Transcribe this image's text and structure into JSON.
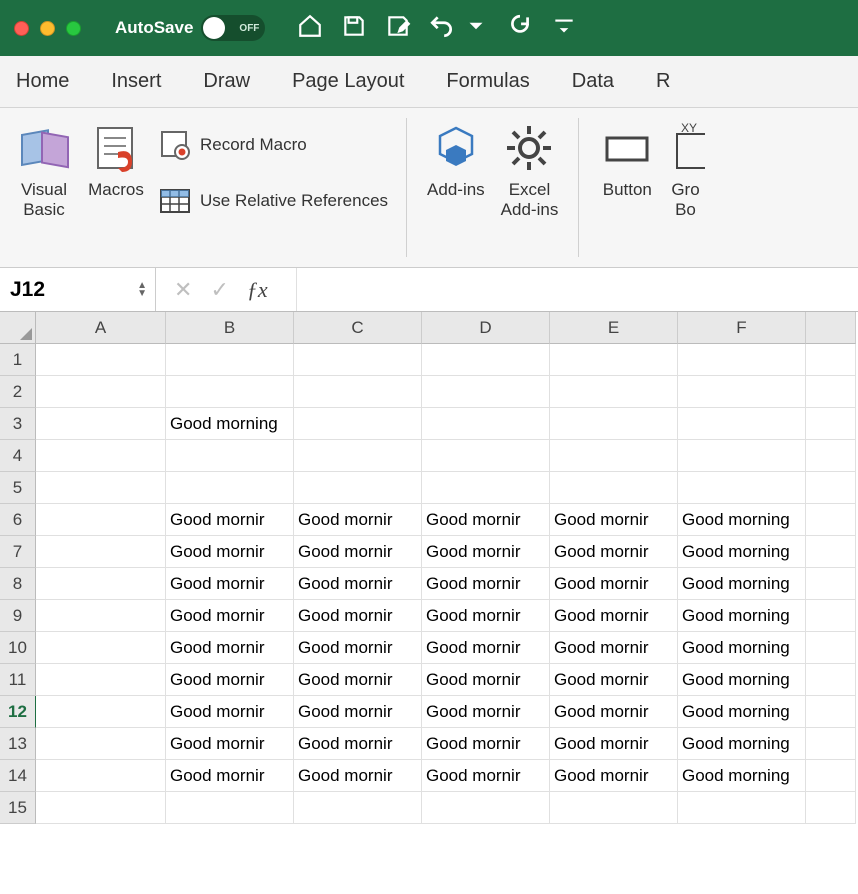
{
  "titlebar": {
    "autosave_label": "AutoSave",
    "autosave_state": "OFF"
  },
  "tabs": [
    "Home",
    "Insert",
    "Draw",
    "Page Layout",
    "Formulas",
    "Data",
    "R"
  ],
  "ribbon": {
    "visual_basic": "Visual\nBasic",
    "macros": "Macros",
    "record_macro": "Record Macro",
    "use_relative": "Use Relative References",
    "addins": "Add-ins",
    "excel_addins": "Excel\nAdd-ins",
    "button": "Button",
    "group_box": "Gro\nBo",
    "xy": "XY"
  },
  "formula_bar": {
    "name_box": "J12",
    "value": ""
  },
  "grid": {
    "col_widths": {
      "A": 130,
      "B": 128,
      "C": 128,
      "D": 128,
      "E": 128,
      "F": 128,
      "G": 50
    },
    "columns": [
      "A",
      "B",
      "C",
      "D",
      "E",
      "F"
    ],
    "rows": [
      1,
      2,
      3,
      4,
      5,
      6,
      7,
      8,
      9,
      10,
      11,
      12,
      13,
      14,
      15
    ],
    "selected_row": 12,
    "cells": {
      "B3": "Good morning",
      "B6": "Good mornir",
      "C6": "Good mornir",
      "D6": "Good mornir",
      "E6": "Good mornir",
      "F6": "Good morning",
      "B7": "Good mornir",
      "C7": "Good mornir",
      "D7": "Good mornir",
      "E7": "Good mornir",
      "F7": "Good morning",
      "B8": "Good mornir",
      "C8": "Good mornir",
      "D8": "Good mornir",
      "E8": "Good mornir",
      "F8": "Good morning",
      "B9": "Good mornir",
      "C9": "Good mornir",
      "D9": "Good mornir",
      "E9": "Good mornir",
      "F9": "Good morning",
      "B10": "Good mornir",
      "C10": "Good mornir",
      "D10": "Good mornir",
      "E10": "Good mornir",
      "F10": "Good morning",
      "B11": "Good mornir",
      "C11": "Good mornir",
      "D11": "Good mornir",
      "E11": "Good mornir",
      "F11": "Good morning",
      "B12": "Good mornir",
      "C12": "Good mornir",
      "D12": "Good mornir",
      "E12": "Good mornir",
      "F12": "Good morning",
      "B13": "Good mornir",
      "C13": "Good mornir",
      "D13": "Good mornir",
      "E13": "Good mornir",
      "F13": "Good morning",
      "B14": "Good mornir",
      "C14": "Good mornir",
      "D14": "Good mornir",
      "E14": "Good mornir",
      "F14": "Good morning"
    },
    "overflow_cells": [
      "B3",
      "F6",
      "F7",
      "F8",
      "F9",
      "F10",
      "F11",
      "F12",
      "F13",
      "F14"
    ]
  }
}
